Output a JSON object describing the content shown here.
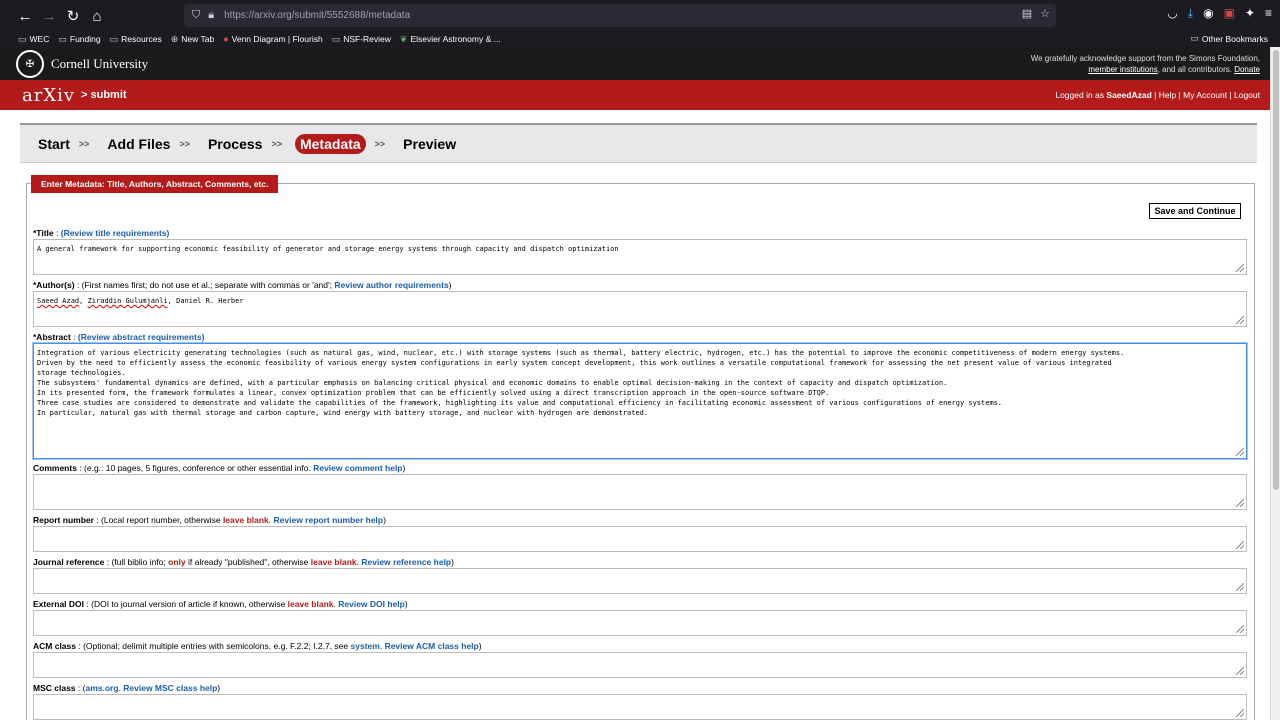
{
  "browser": {
    "url": "https://arxiv.org/submit/5552688/metadata",
    "bookmarks": [
      "WEC",
      "Funding",
      "Resources",
      "New Tab",
      "Venn Diagram | Flourish",
      "NSF-Review",
      "Elsevier Astronomy & ..."
    ],
    "other_bookmarks": "Other Bookmarks"
  },
  "cornell": {
    "name": "Cornell University",
    "ack_line1": "We gratefully acknowledge support from the Simons Foundation,",
    "ack_member": "member institutions",
    "ack_mid": ", and all contributors.",
    "ack_donate": "Donate"
  },
  "arxiv": {
    "logo": "arXiv",
    "submit": "> submit",
    "logged_in_as": "Logged in as",
    "user": "SaeedAzad",
    "help": "Help",
    "my_account": "My Account",
    "logout": "Logout"
  },
  "steps": {
    "start": "Start",
    "add_files": "Add Files",
    "process": "Process",
    "metadata": "Metadata",
    "preview": "Preview",
    "sep": ">>"
  },
  "form": {
    "tab_title": "Enter Metadata: Title, Authors, Abstract, Comments, etc.",
    "save_button": "Save and Continue",
    "title": {
      "label": "*Title",
      "help": "(Review title requirements)",
      "value": "A general framework for supporting economic feasibility of generator and storage energy systems through capacity and dispatch optimization"
    },
    "authors": {
      "label": "*Author(s)",
      "hint": ": (First names first; do not use et al.; separate with commas or 'and';",
      "help": "Review author requirements",
      "close": ")",
      "a1": "Saeed Azad",
      "a2": "Ziraddin Gulumjanli",
      "a3": "Daniel R. Herber"
    },
    "abstract": {
      "label": "*Abstract",
      "help": "(Review abstract requirements)",
      "lines": [
        "Integration of various electricity generating technologies (such as natural gas, wind, nuclear, etc.) with storage systems (such as thermal, battery electric, hydrogen, etc.) has the potential to improve the economic competitiveness of modern energy systems.",
        "Driven by the need to efficiently assess the economic feasibility of various energy system configurations in early system concept development, this work outlines a versatile computational framework for assessing the net present value of various integrated",
        "storage technologies.",
        "The subsystems' fundamental dynamics are defined, with a particular emphasis on balancing critical physical and economic domains to enable optimal decision-making in the context of capacity and dispatch optimization.",
        "In its presented form, the framework formulates a linear, convex optimization problem that can be efficiently solved using a direct transcription approach in the open-source software DTQP.",
        "Three case studies are considered to demonstrate and validate the capabilities of the framework, highlighting its value and computational efficiency in facilitating economic assessment of various configurations of energy systems.",
        "In particular, natural gas with thermal storage and carbon capture, wind energy with battery storage, and nuclear with hydrogen are demonstrated."
      ]
    },
    "comments": {
      "label": "Comments",
      "hint": ": (e.g.: 10 pages, 5 figures, conference or other essential info.",
      "help": "Review comment help",
      "close": ")"
    },
    "report": {
      "label": "Report number",
      "hint": ": (Local report number, otherwise",
      "blank": "leave blank",
      "help": "Review report number help",
      "close": ")"
    },
    "journal": {
      "label": "Journal reference",
      "hint": ": (full biblio info;",
      "only": "only",
      "hint2": "if already \"published\", otherwise",
      "blank": "leave blank",
      "help": "Review reference help",
      "close": ")"
    },
    "doi": {
      "label": "External DOI",
      "hint": ": (DOI to journal version of article if known, otherwise",
      "blank": "leave blank",
      "help": "Review DOI help",
      "close": ")"
    },
    "acm": {
      "label": "ACM class",
      "hint": ": (Optional; delimit multiple entries with semicolons, e.g. F.2.2; I.2.7, see",
      "system": "system",
      "help": "Review ACM class help",
      "close": ")"
    },
    "msc": {
      "label": "MSC class",
      "hint": ": (",
      "ams": "ams.org",
      "help": "Review MSC class help",
      "close": ")"
    }
  }
}
